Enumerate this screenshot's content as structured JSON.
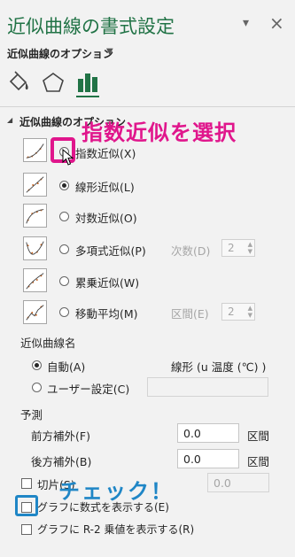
{
  "pane": {
    "title": "近似曲線の書式設定",
    "pin_glyph": "▾",
    "close_glyph": "×",
    "options_label": "近似曲線のオプション",
    "options_caret": "▼"
  },
  "tabs": [
    {
      "name": "fill-line",
      "icon": "paint-bucket-icon"
    },
    {
      "name": "effects",
      "icon": "pentagon-icon"
    },
    {
      "name": "trendline-options",
      "icon": "bar-chart-icon",
      "selected": true
    }
  ],
  "section": {
    "collapse_glyph": "◢",
    "label": "近似曲線のオプション"
  },
  "types": [
    {
      "label": "指数近似(X)",
      "selected": false
    },
    {
      "label": "線形近似(L)",
      "selected": true
    },
    {
      "label": "対数近似(O)",
      "selected": false
    },
    {
      "label": "多項式近似(P)",
      "selected": false,
      "extra_label": "次数(D)",
      "extra_value": "2"
    },
    {
      "label": "累乗近似(W)",
      "selected": false
    },
    {
      "label": "移動平均(M)",
      "selected": false,
      "extra_label": "区間(E)",
      "extra_value": "2"
    }
  ],
  "name_section": {
    "label": "近似曲線名",
    "auto_label": "自動(A)",
    "auto_value": "線形 (u 温度 (℃) )",
    "custom_label": "ユーザー設定(C)",
    "custom_value": ""
  },
  "forecast": {
    "label": "予測",
    "forward_label": "前方補外(F)",
    "forward_value": "0.0",
    "forward_unit": "区間",
    "backward_label": "後方補外(B)",
    "backward_value": "0.0",
    "backward_unit": "区間"
  },
  "intercept": {
    "label": "切片(S)",
    "value": "0.0"
  },
  "display_equation": {
    "label": "グラフに数式を表示する(E)",
    "checked": false
  },
  "display_r2": {
    "label": "グラフに R-2 乗値を表示する(R)",
    "checked": false
  },
  "annotations": {
    "select_exponential": "指数近似を選択",
    "check": "チェック！"
  },
  "colors": {
    "accent": "#217346",
    "annotation_pink": "#e0168c",
    "annotation_blue": "#1f86c6"
  }
}
